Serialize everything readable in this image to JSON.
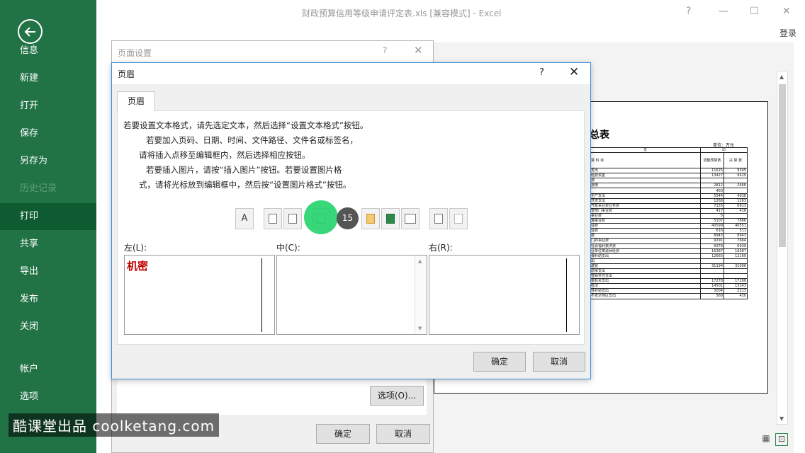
{
  "app": {
    "window_title": "财政预算信用等级申请评定表.xls  [兼容模式] - Excel",
    "signin": "登录",
    "help_glyph": "?",
    "min_glyph": "—",
    "max_glyph": "☐",
    "close_glyph": "✕"
  },
  "backstage": {
    "items": [
      {
        "label": "信息"
      },
      {
        "label": "新建"
      },
      {
        "label": "打开"
      },
      {
        "label": "保存"
      },
      {
        "label": "另存为"
      },
      {
        "label": "历史记录"
      },
      {
        "label": "打印"
      },
      {
        "label": "共享"
      },
      {
        "label": "导出"
      },
      {
        "label": "发布"
      },
      {
        "label": "关闭"
      },
      {
        "label": "帐户"
      },
      {
        "label": "选项"
      }
    ],
    "selected": "打印",
    "accent": "#217346"
  },
  "page_setup": {
    "title": "页面设置",
    "help": "?",
    "close": "✕",
    "options_button": "选项(O)...",
    "ok": "确定",
    "cancel": "取消"
  },
  "header_dialog": {
    "title": "页眉",
    "help": "?",
    "close": "✕",
    "tab": "页眉",
    "instructions": [
      "若要设置文本格式，请先选定文本，然后选择“设置文本格式”按钮。",
      "若要加入页码、日期、时间、文件路径、文件名或标签名，",
      "请将插入点移至编辑框内，然后选择相应按钮。",
      "若要插入图片，请按“插入图片”按钮。若要设置图片格",
      "式，请将光标放到编辑框中，然后按“设置图片格式”按钮。"
    ],
    "toolbar": {
      "font_button": "A",
      "step_badge": "15",
      "icons": [
        "format-text-icon",
        "page-number-icon",
        "page-count-icon",
        "date-icon",
        "time-icon",
        "file-path-icon",
        "file-name-icon",
        "sheet-name-icon",
        "insert-picture-icon",
        "format-picture-icon"
      ]
    },
    "sections": {
      "left_label": "左(L):",
      "center_label": "中(C):",
      "right_label": "右(R):",
      "left_value": "机密",
      "center_value": "",
      "right_value": ""
    },
    "ok": "确定",
    "cancel": "取消"
  },
  "preview": {
    "title": "总表",
    "unit": "单位：万元",
    "header_left": "支",
    "header_right": "出",
    "col_subject": "算        科        目",
    "col_budget": "调整预算数",
    "col_final": "决 算 数",
    "rows": [
      [
        "支出",
        "11625",
        "9305"
      ],
      [
        "经费资金",
        "13427",
        "9429"
      ],
      [
        "费",
        "",
        ""
      ],
      [
        "费用",
        "2812",
        "2668"
      ],
      [
        "",
        "460",
        ""
      ],
      [
        "生产支出",
        "5544",
        "4938"
      ],
      [
        "开发支出",
        "1268",
        "1263"
      ],
      [
        "气象事业费业务费",
        "7133",
        "6913"
      ],
      [
        "管部门事业费",
        "417",
        "416"
      ],
      [
        "事业费",
        "5",
        ""
      ],
      [
        "海事业费",
        "5107",
        "7866"
      ],
      [
        "业费",
        "40599",
        "40551"
      ],
      [
        "业费",
        "616",
        "511"
      ],
      [
        "费",
        "8943",
        "8943"
      ],
      [
        "门的事业费",
        "9291",
        "7664"
      ],
      [
        "社会福利救济费",
        "6978",
        "6939"
      ],
      [
        "业单位离退休经费",
        "16387",
        "16387"
      ],
      [
        "弹补助支出",
        "12665",
        "12160"
      ],
      [
        "出",
        "",
        ""
      ],
      [
        "建费",
        "31194",
        "31006"
      ],
      [
        "动事支出",
        "",
        ""
      ],
      [
        "智服务性支出",
        "",
        ""
      ],
      [
        "批机关支出",
        "17278",
        "17268"
      ],
      [
        "检法",
        "14501",
        "13143"
      ],
      [
        "性补贴支出",
        "3004",
        "2213"
      ],
      [
        "不发达地区支出",
        "568",
        "420"
      ]
    ]
  },
  "watermark": "酷课堂出品 coolketang.com"
}
